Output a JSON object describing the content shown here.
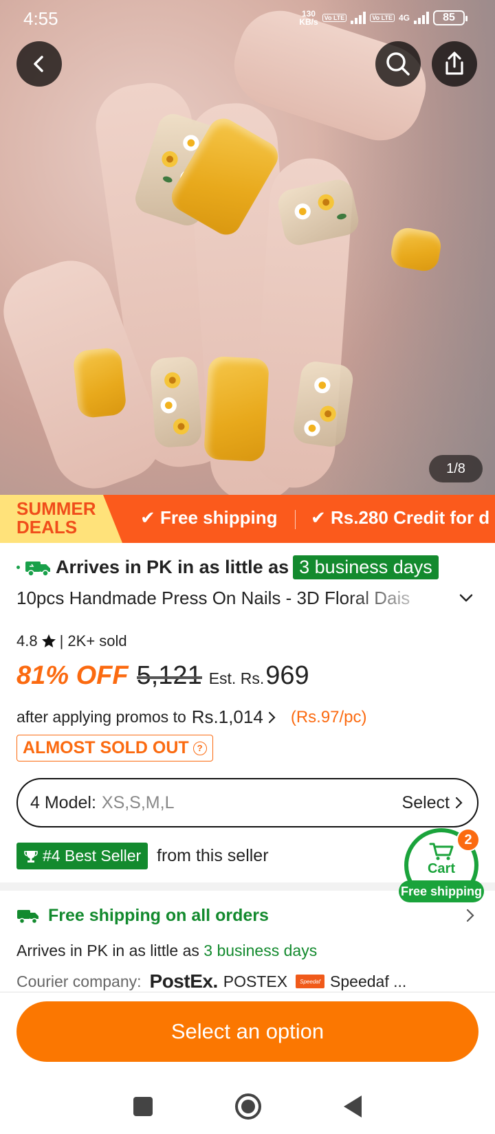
{
  "status_bar": {
    "time": "4:55",
    "net_speed_top": "130",
    "net_speed_bottom": "KB/s",
    "volte1": "Vo LTE",
    "volte2": "Vo LTE",
    "network": "4G",
    "battery": "85"
  },
  "gallery": {
    "counter": "1/8",
    "image_desc_icon": "nail-photo"
  },
  "banner": {
    "deals_line1": "SUMMER",
    "deals_line2": "DEALS",
    "perk1": "Free shipping",
    "perk2": "Rs.280 Credit for d"
  },
  "product": {
    "arrives_text": "Arrives in PK in as little as",
    "arrives_days": "3 business days",
    "title": "10pcs Handmade Press On Nails - 3D Floral Dais",
    "rating": "4.8",
    "sold": "| 2K+ sold",
    "discount": "81% OFF",
    "original_price": "5,121",
    "est_label": "Est. Rs.",
    "final_price": "969",
    "promo_text": "after applying promos to",
    "promo_amount": "Rs.1,014",
    "per_piece": "(Rs.97/pc)",
    "stock_badge": "ALMOST SOLD OUT",
    "model_label": "4 Model:",
    "model_values": "XS,S,M,L",
    "model_select": "Select",
    "best_seller": "#4 Best Seller",
    "from_seller": "from this seller"
  },
  "cart": {
    "label": "Cart",
    "badge": "2",
    "free_shipping": "Free shipping"
  },
  "shipping": {
    "headline": "Free shipping on all orders",
    "arrives_text": "Arrives in PK in as little as",
    "arrives_days": "3 business days",
    "courier_label": "Courier company:",
    "postex_logo": "PostEx.",
    "postex_name": "POSTEX",
    "speedaf_logo": "Speedaf",
    "speedaf_name": "Speedaf ..."
  },
  "cta": {
    "label": "Select an option"
  },
  "colors": {
    "accent_orange": "#fb7701",
    "banner_orange": "#fb5a1c",
    "green": "#138a2e"
  }
}
